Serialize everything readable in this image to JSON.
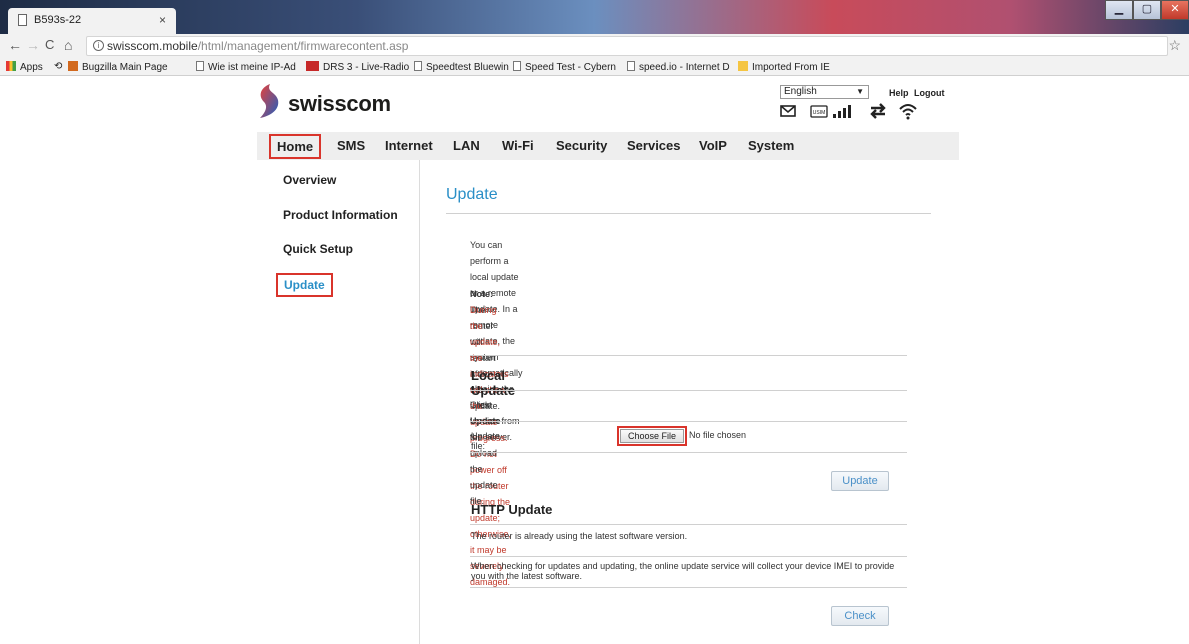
{
  "browser": {
    "tab_title": "B593s-22",
    "tab_close": "×",
    "url_host": "swisscom.mobile",
    "url_path": "/html/management/firmwarecontent.asp",
    "nav_back": "←",
    "nav_forward": "→",
    "nav_reload": "C",
    "nav_home": "⌂",
    "star": "☆",
    "bookmarks": [
      {
        "label": "Apps"
      },
      {
        "label": "Bugzilla Main Page"
      },
      {
        "label": "Wie ist meine IP-Ad"
      },
      {
        "label": "DRS 3 - Live-Radio"
      },
      {
        "label": "Speedtest Bluewin"
      },
      {
        "label": "Speed Test - Cybern"
      },
      {
        "label": "speed.io - Internet D"
      },
      {
        "label": "Imported From IE"
      }
    ]
  },
  "header": {
    "logo_text": "swisscom",
    "language": "English",
    "help_label": "Help",
    "logout_label": "Logout",
    "status_icons": [
      "envelope-icon",
      "usim-icon",
      "signal-bars-icon",
      "data-transfer-icon",
      "wifi-icon"
    ]
  },
  "menu": {
    "items": [
      "Home",
      "SMS",
      "Internet",
      "LAN",
      "Wi-Fi",
      "Security",
      "Services",
      "VoIP",
      "System"
    ]
  },
  "sidenav": {
    "items": [
      "Overview",
      "Product Information",
      "Quick Setup",
      "Update"
    ]
  },
  "main": {
    "title": "Update",
    "intro_line1": "You can perform a local update or a remote update. In a remote update, the system automatically obtains the",
    "intro_line2": "latest version from the server.",
    "note_label": "Note:",
    "note_text": " The router will restart after the update.",
    "warning_line1": "During the update, the indicators will show the update progress. Do not power off the router during the",
    "warning_line2": "update; otherwise, it may be severely damaged.",
    "local": {
      "title": "Local Update",
      "instruction_prefix": "Click ",
      "instruction_bold": "Update",
      "instruction_suffix": " to upload the update file.",
      "file_label": "Update file:",
      "choose_file": "Choose File",
      "no_file": "No file chosen",
      "update_button": "Update"
    },
    "http": {
      "title": "HTTP Update",
      "status": "The router is already using the latest software version.",
      "imei_line1": "When checking for updates and updating, the online update service will collect your device IMEI to provide",
      "imei_line2": "you with the latest software.",
      "check_button": "Check"
    }
  },
  "colors": {
    "accent": "#2a8fc7",
    "highlight_box": "#d9342b",
    "warning_text": "#c0392b"
  }
}
